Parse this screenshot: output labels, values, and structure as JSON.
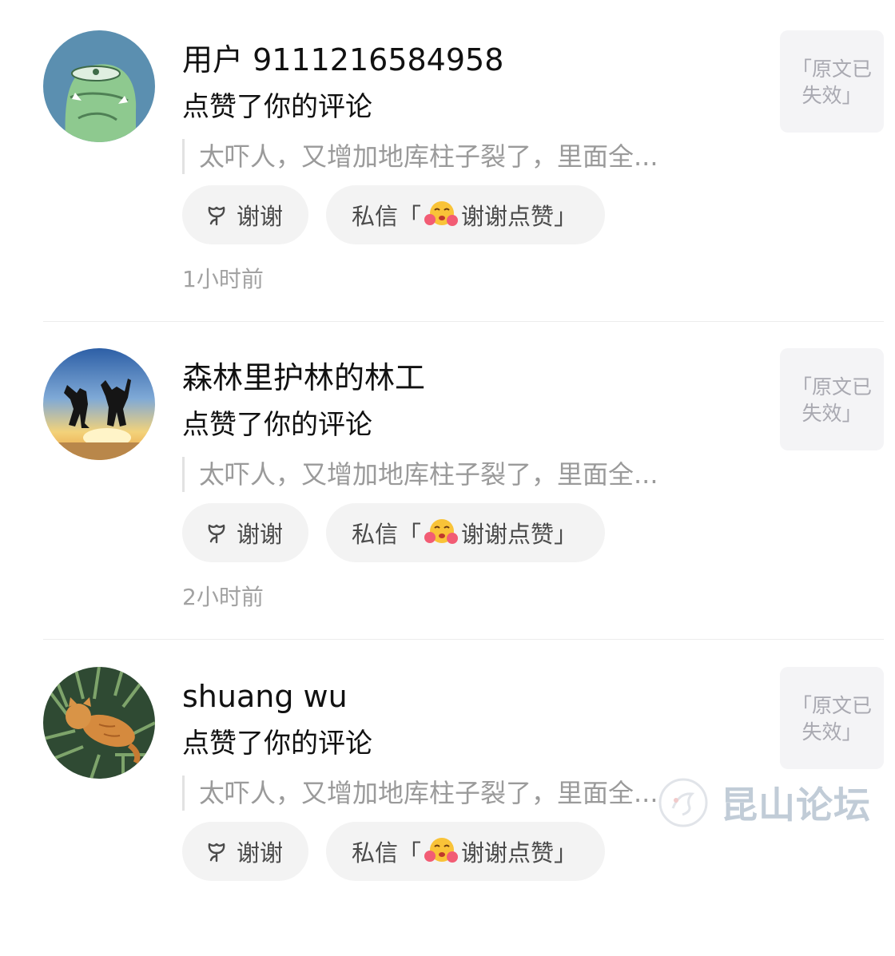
{
  "notifications": [
    {
      "avatar": "green-cartoon-avatar",
      "user": "用户 9111216584958",
      "action": "点赞了你的评论",
      "comment": "太吓人，又增加地库柱子裂了，里面全...",
      "thanks_label": "谢谢",
      "dm_prefix": "私信「",
      "dm_text": "谢谢点赞」",
      "time": "1小时前",
      "post_line1": "「原文已",
      "post_line2": "失效」"
    },
    {
      "avatar": "sunset-jumping-avatar",
      "user": "森林里护林的林工",
      "action": "点赞了你的评论",
      "comment": "太吓人，又增加地库柱子裂了，里面全...",
      "thanks_label": "谢谢",
      "dm_prefix": "私信「",
      "dm_text": "谢谢点赞」",
      "time": "2小时前",
      "post_line1": "「原文已",
      "post_line2": "失效」"
    },
    {
      "avatar": "cat-in-grass-avatar",
      "user": "shuang wu",
      "action": "点赞了你的评论",
      "comment": "太吓人，又增加地库柱子裂了，里面全...",
      "thanks_label": "谢谢",
      "dm_prefix": "私信「",
      "dm_text": "谢谢点赞」",
      "time": "",
      "post_line1": "「原文已",
      "post_line2": "失效」"
    }
  ],
  "watermark": "昆山论坛",
  "colors": {
    "background": "#ffffff",
    "button_bg": "#f3f3f3",
    "secondary_text": "#9a9a9a",
    "thumb_bg": "#f4f4f6"
  }
}
